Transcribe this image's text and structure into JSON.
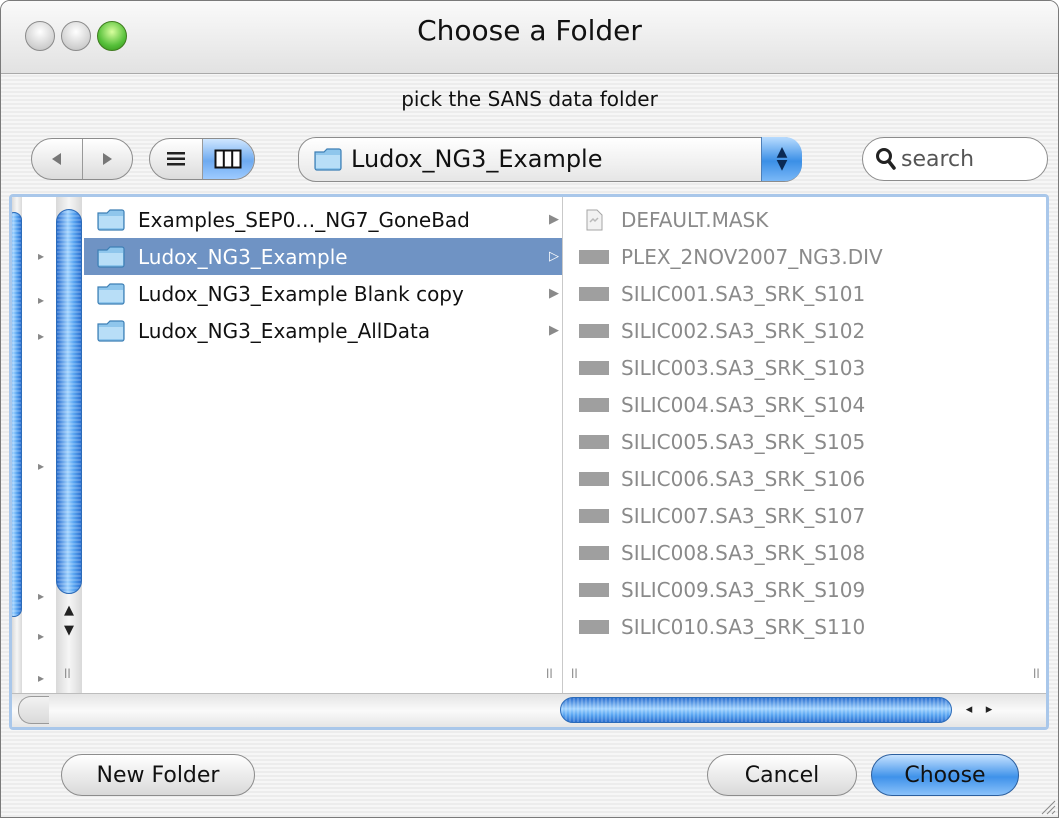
{
  "window": {
    "title": "Choose a Folder"
  },
  "prompt": "pick the SANS data folder",
  "toolbar": {
    "back_icon": "back-arrow-icon",
    "forward_icon": "forward-arrow-icon",
    "list_view_icon": "list-view-icon",
    "column_view_icon": "column-view-icon"
  },
  "location": {
    "label": "Ludox_NG3_Example",
    "icon": "folder-icon"
  },
  "search": {
    "placeholder": "search",
    "value": ""
  },
  "column_b": {
    "items": [
      {
        "label": "Examples_SEP0…_NG7_GoneBad",
        "selected": false
      },
      {
        "label": "Ludox_NG3_Example",
        "selected": true
      },
      {
        "label": "Ludox_NG3_Example Blank copy",
        "selected": false
      },
      {
        "label": "Ludox_NG3_Example_AllData",
        "selected": false
      }
    ]
  },
  "column_c": {
    "items": [
      {
        "label": "DEFAULT.MASK",
        "icon": "document-icon"
      },
      {
        "label": "PLEX_2NOV2007_NG3.DIV",
        "icon": "file-icon"
      },
      {
        "label": "SILIC001.SA3_SRK_S101",
        "icon": "file-icon"
      },
      {
        "label": "SILIC002.SA3_SRK_S102",
        "icon": "file-icon"
      },
      {
        "label": "SILIC003.SA3_SRK_S103",
        "icon": "file-icon"
      },
      {
        "label": "SILIC004.SA3_SRK_S104",
        "icon": "file-icon"
      },
      {
        "label": "SILIC005.SA3_SRK_S105",
        "icon": "file-icon"
      },
      {
        "label": "SILIC006.SA3_SRK_S106",
        "icon": "file-icon"
      },
      {
        "label": "SILIC007.SA3_SRK_S107",
        "icon": "file-icon"
      },
      {
        "label": "SILIC008.SA3_SRK_S108",
        "icon": "file-icon"
      },
      {
        "label": "SILIC009.SA3_SRK_S109",
        "icon": "file-icon"
      },
      {
        "label": "SILIC010.SA3_SRK_S110",
        "icon": "file-icon"
      }
    ]
  },
  "buttons": {
    "new_folder": "New Folder",
    "cancel": "Cancel",
    "choose": "Choose"
  },
  "colors": {
    "selection": "#6f93c4",
    "scroll_blue": "#3f92ea",
    "dimmed_text": "#8a8a8a"
  }
}
